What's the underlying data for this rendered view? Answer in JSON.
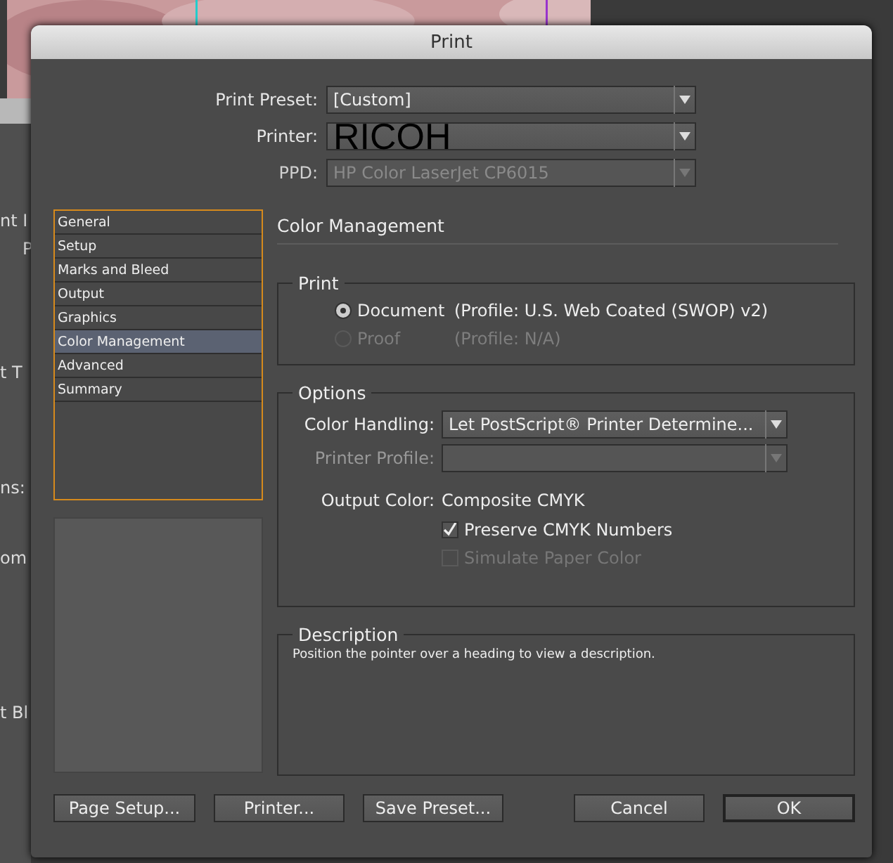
{
  "background": {
    "fragments": [
      "nt I",
      "P",
      "t T",
      "ns:",
      "om",
      "t Bl"
    ]
  },
  "dialog": {
    "title": "Print",
    "presets": [
      {
        "label": "Print Preset:",
        "value": "[Custom]",
        "disabled": false
      },
      {
        "label": "Printer:",
        "overlay_value": "RICOH",
        "disabled": false
      },
      {
        "label": "PPD:",
        "value": "HP Color LaserJet CP6015",
        "disabled": true
      }
    ],
    "sidebar": {
      "items": [
        {
          "label": "General",
          "selected": false
        },
        {
          "label": "Setup",
          "selected": false
        },
        {
          "label": "Marks and Bleed",
          "selected": false
        },
        {
          "label": "Output",
          "selected": false
        },
        {
          "label": "Graphics",
          "selected": false
        },
        {
          "label": "Color Management",
          "selected": true
        },
        {
          "label": "Advanced",
          "selected": false
        },
        {
          "label": "Summary",
          "selected": false
        }
      ]
    },
    "panel": {
      "heading": "Color Management",
      "print_group": {
        "title": "Print",
        "options": [
          {
            "label": "Document",
            "profile": "(Profile: U.S. Web Coated (SWOP) v2)",
            "selected": true,
            "disabled": false
          },
          {
            "label": "Proof",
            "profile": "(Profile: N/A)",
            "selected": false,
            "disabled": true
          }
        ]
      },
      "options_group": {
        "title": "Options",
        "color_handling": {
          "label": "Color Handling:",
          "value": "Let PostScript® Printer Determine...",
          "disabled": false
        },
        "printer_profile": {
          "label": "Printer Profile:",
          "disabled": true
        },
        "output_color": {
          "label": "Output Color:",
          "value": "Composite CMYK"
        },
        "checkboxes": [
          {
            "label": "Preserve CMYK Numbers",
            "checked": true,
            "disabled": false
          },
          {
            "label": "Simulate Paper Color",
            "checked": false,
            "disabled": true
          }
        ]
      },
      "description": {
        "title": "Description",
        "text": "Position the pointer over a heading to view a description."
      }
    },
    "buttons": [
      {
        "label": "Page Setup...",
        "default": false
      },
      {
        "label": "Printer...",
        "default": false
      },
      {
        "label": "Save Preset...",
        "default": false
      },
      {
        "label": "Cancel",
        "default": false
      },
      {
        "label": "OK",
        "default": true
      }
    ]
  }
}
